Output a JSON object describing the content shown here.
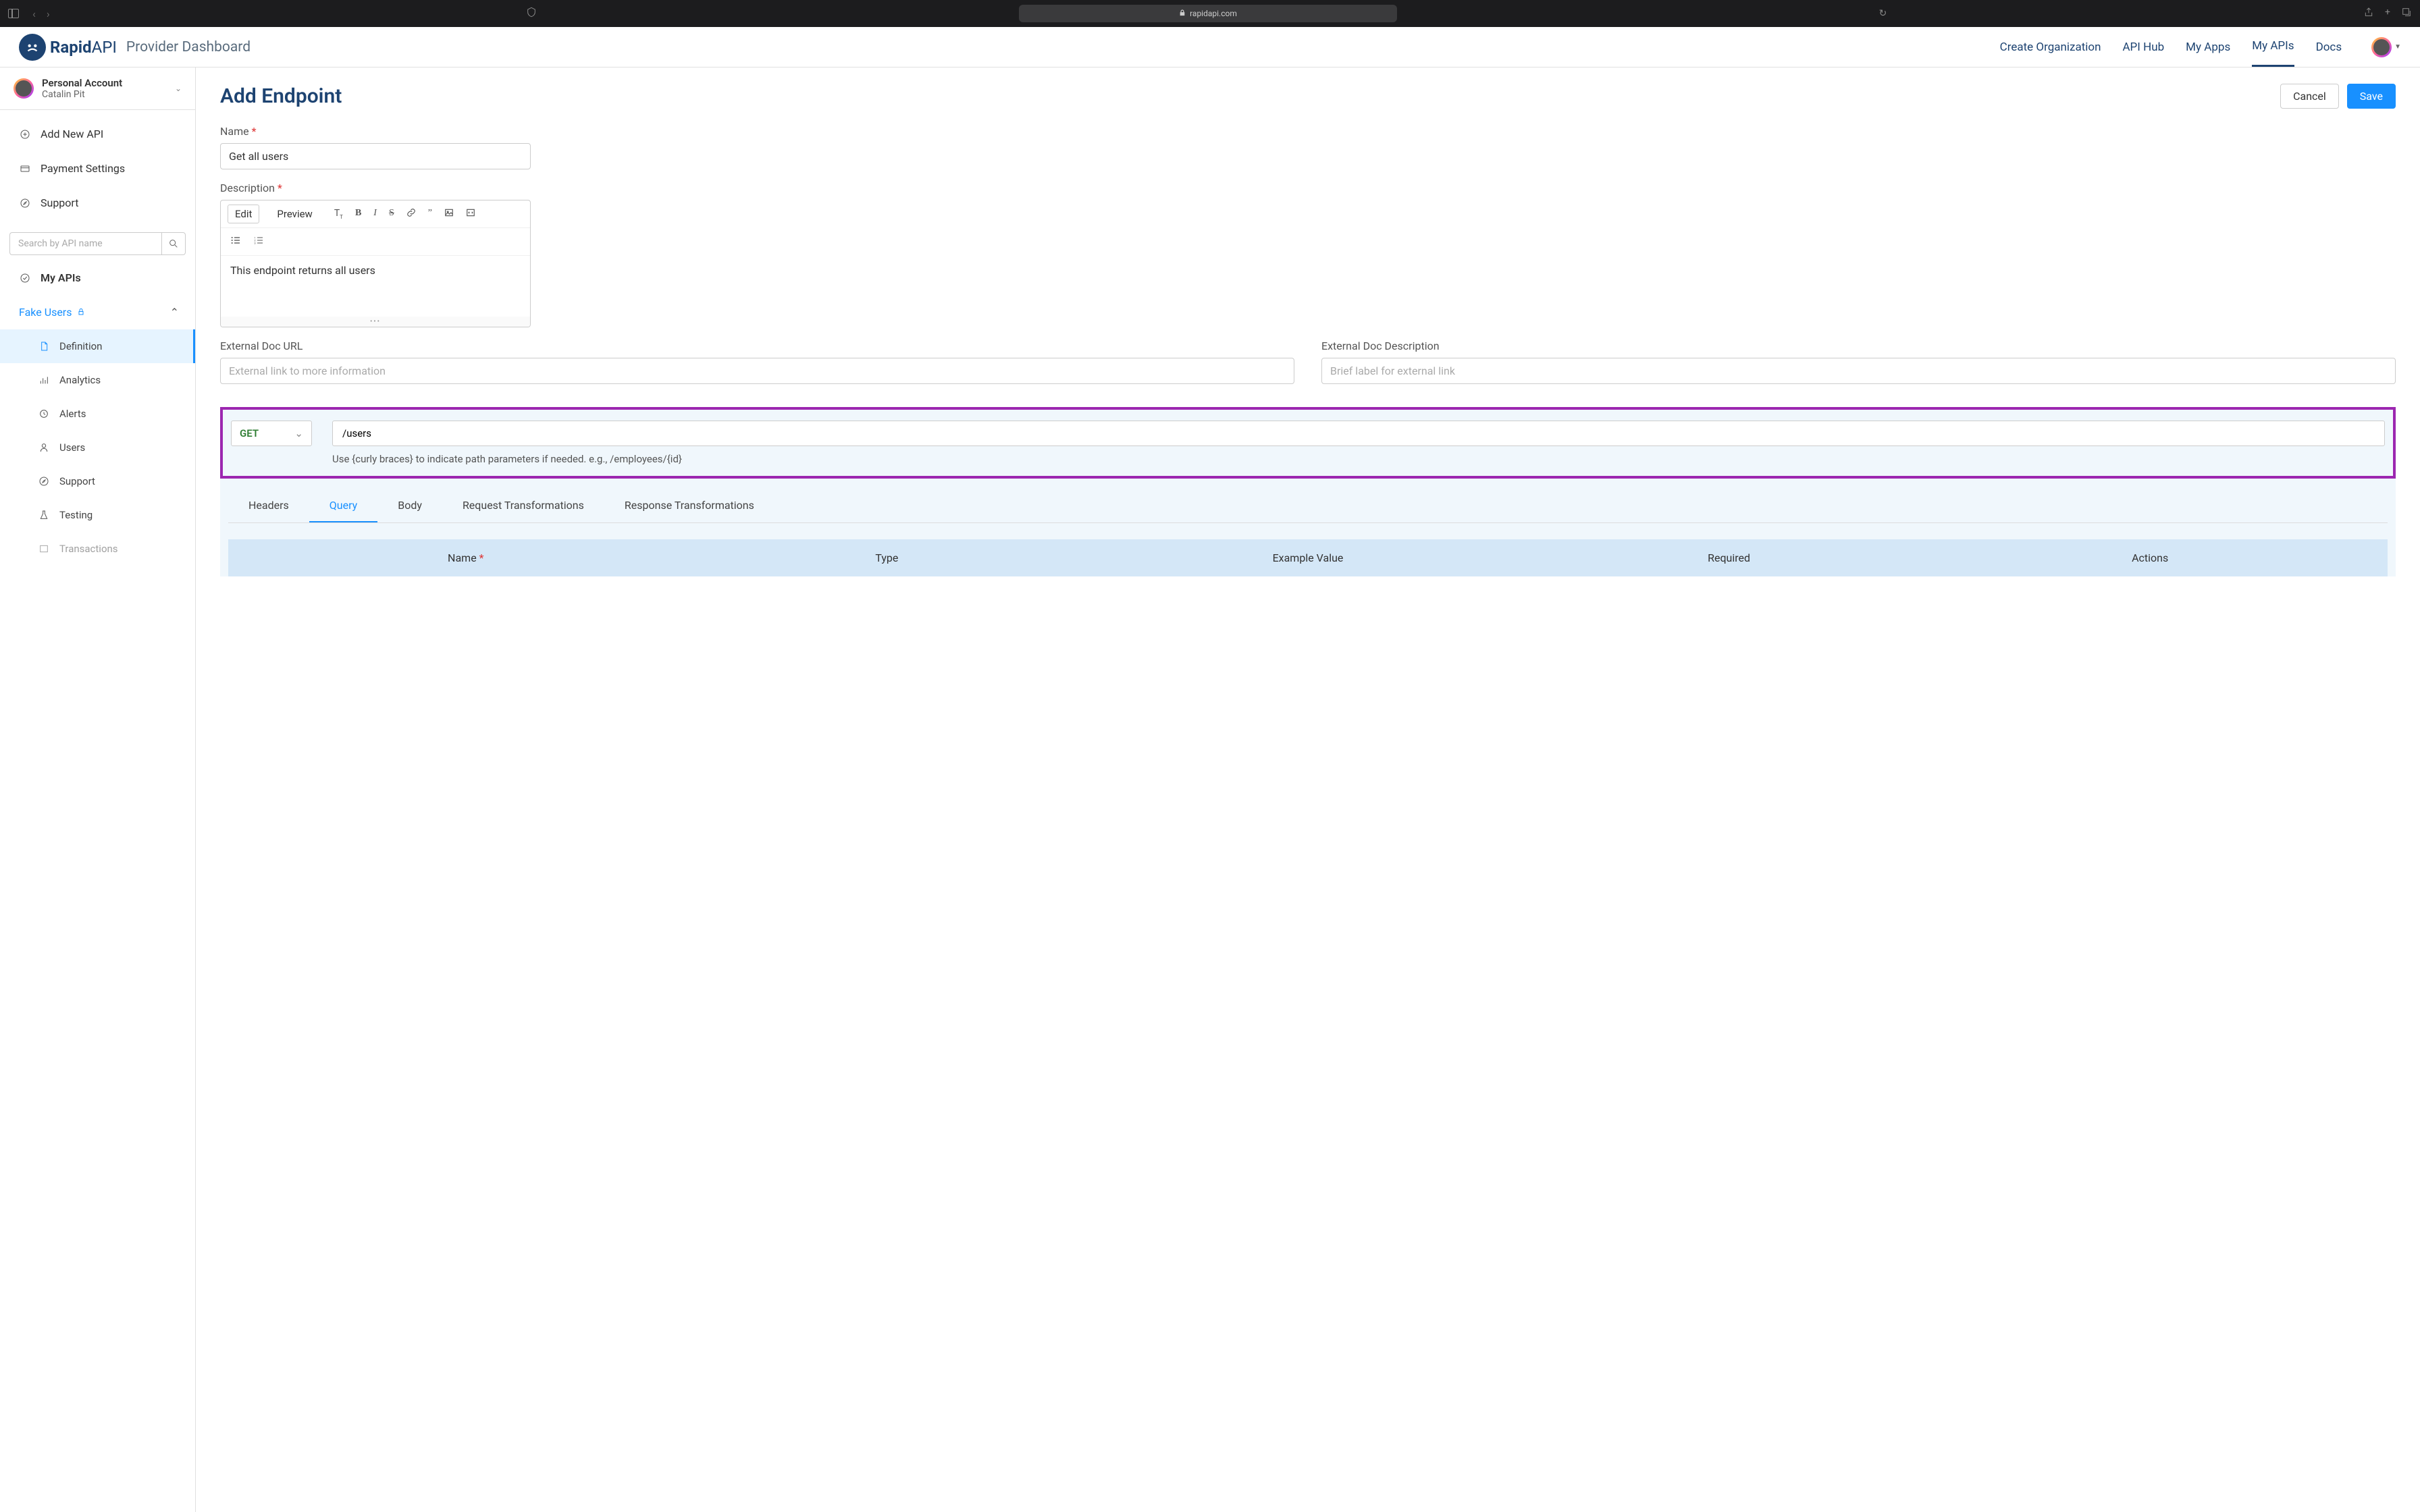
{
  "browser": {
    "url": "rapidapi.com"
  },
  "header": {
    "logo_text_bold": "Rapid",
    "logo_text_light": "API",
    "dashboard_label": "Provider Dashboard",
    "nav": {
      "create_org": "Create Organization",
      "api_hub": "API Hub",
      "my_apps": "My Apps",
      "my_apis": "My APIs",
      "docs": "Docs"
    }
  },
  "sidebar": {
    "account_label": "Personal Account",
    "account_name": "Catalin Pit",
    "add_new_api": "Add New API",
    "payment_settings": "Payment Settings",
    "support": "Support",
    "search_placeholder": "Search by API name",
    "my_apis": "My APIs",
    "api_name": "Fake Users",
    "subs": {
      "definition": "Definition",
      "analytics": "Analytics",
      "alerts": "Alerts",
      "users": "Users",
      "support": "Support",
      "testing": "Testing",
      "transactions": "Transactions"
    }
  },
  "content": {
    "title": "Add Endpoint",
    "cancel": "Cancel",
    "save": "Save",
    "name_label": "Name",
    "name_value": "Get all users",
    "description_label": "Description",
    "editor": {
      "edit": "Edit",
      "preview": "Preview",
      "text": "This endpoint returns all users"
    },
    "ext_url_label": "External Doc URL",
    "ext_url_placeholder": "External link to more information",
    "ext_desc_label": "External Doc Description",
    "ext_desc_placeholder": "Brief label for external link",
    "method": "GET",
    "path": "/users",
    "helper": "Use {curly braces} to indicate path parameters if needed. e.g., /employees/{id}",
    "tabs": {
      "headers": "Headers",
      "query": "Query",
      "body": "Body",
      "req_trans": "Request Transformations",
      "res_trans": "Response Transformations"
    },
    "table_headers": {
      "name": "Name",
      "type": "Type",
      "example": "Example Value",
      "required": "Required",
      "actions": "Actions"
    }
  }
}
